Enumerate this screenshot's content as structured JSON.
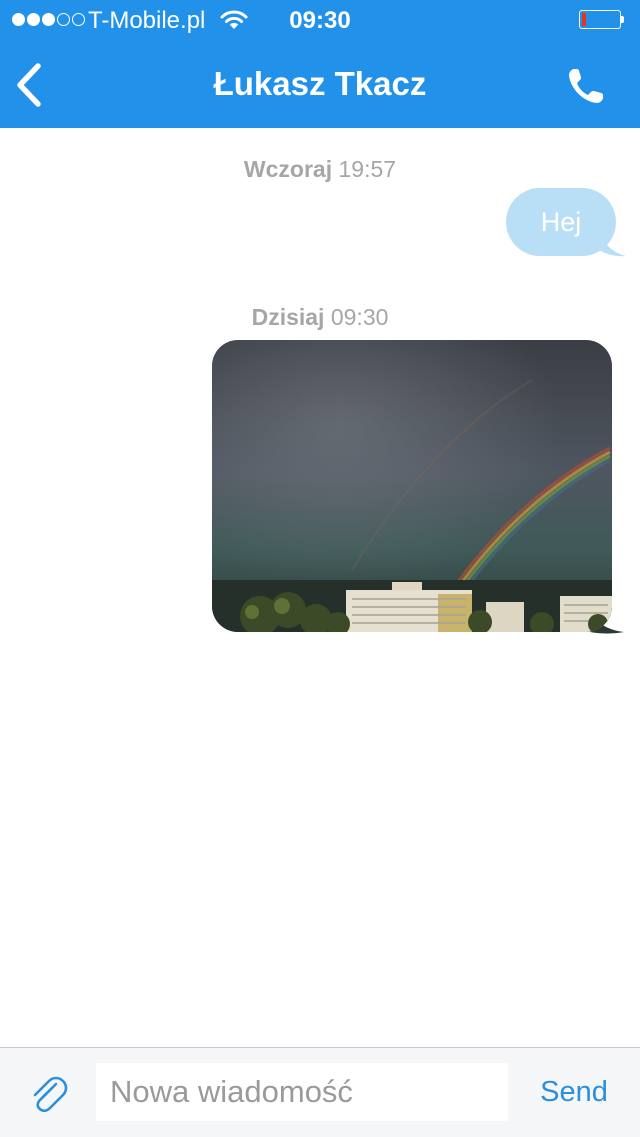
{
  "status_bar": {
    "signal_strength": 3,
    "signal_max": 5,
    "carrier": "T-Mobile.pl",
    "time": "09:30",
    "battery_level": 0.12,
    "battery_color": "#e8331f"
  },
  "nav": {
    "back_icon": "chevron-left-icon",
    "title": "Łukasz Tkacz",
    "call_icon": "phone-icon",
    "background_color": "#2291e9"
  },
  "conversation": {
    "groups": [
      {
        "day": "Wczoraj",
        "time": "19:57",
        "message": {
          "type": "text",
          "text": "Hej",
          "bubble_color": "#b9dff6"
        }
      },
      {
        "day": "Dzisiaj",
        "time": "09:30",
        "message": {
          "type": "image",
          "image": "rainbow-photo"
        }
      }
    ]
  },
  "composer": {
    "attach_icon": "paperclip-icon",
    "placeholder": "Nowa wiadomość",
    "value": "",
    "send_label": "Send",
    "accent_color": "#2b8fdc"
  }
}
